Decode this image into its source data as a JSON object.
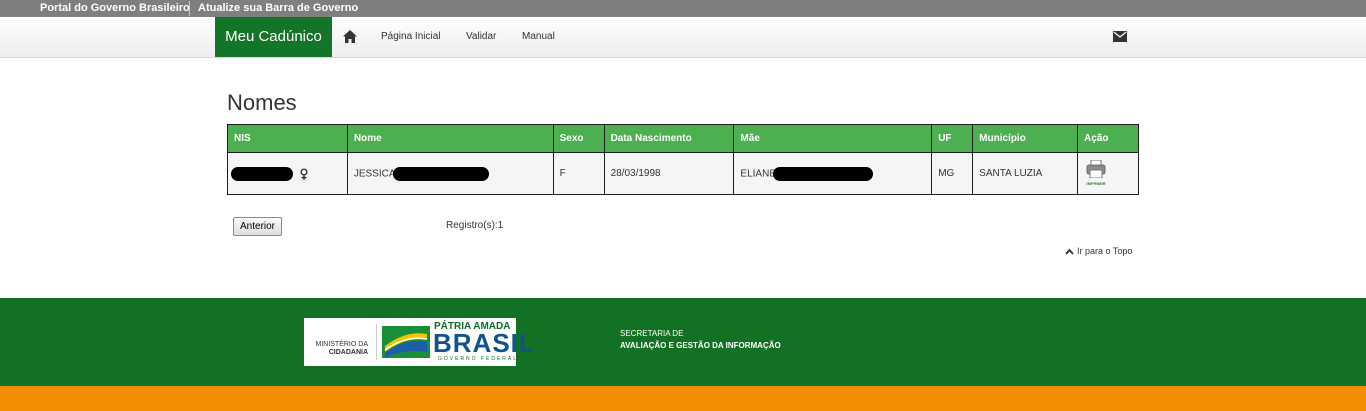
{
  "gov_bar": {
    "portal_label": "Portal do Governo Brasileiro",
    "update_label": "Atualize sua Barra de Governo"
  },
  "navbar": {
    "brand": "Meu Cadúnico",
    "home_icon": "home-icon",
    "items": [
      {
        "label": "Página Inicial"
      },
      {
        "label": "Validar"
      },
      {
        "label": "Manual"
      }
    ],
    "mail_icon": "envelope-icon"
  },
  "page_title": "Nomes",
  "table": {
    "headers": [
      "NIS",
      "Nome",
      "Sexo",
      "Data Nascimento",
      "Mãe",
      "UF",
      "Município",
      "Ação"
    ],
    "rows": [
      {
        "nis": "",
        "nome": "JESSICA",
        "sexo": "F",
        "data_nascimento": "28/03/1998",
        "mae": "ELIANE",
        "uf": "MG",
        "municipio": "SANTA LUZIA",
        "acao_label": "IMPRIMIR"
      }
    ]
  },
  "pagination": {
    "prev_label": "Anterior",
    "records": "Registro(s):1"
  },
  "to_top": "Ir para o Topo",
  "footer": {
    "ministry_line1": "MINISTÉRIO DA",
    "ministry_line2": "CIDADANIA",
    "patria": "PÁTRIA AMADA",
    "brasil": "BRASIL",
    "governo": "GOVERNO FEDERAL",
    "secretaria_line1": "SECRETARIA DE",
    "secretaria_line2": "AVALIAÇÃO E GESTÃO DA INFORMAÇÃO"
  },
  "colors": {
    "gov_bar": "#7f7f7f",
    "brand_green": "#137527",
    "table_header_green": "#4cb050",
    "footer_green": "#137123",
    "footer_orange": "#f18d00"
  }
}
